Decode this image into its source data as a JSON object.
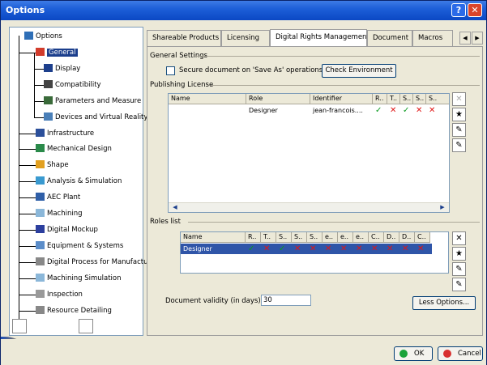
{
  "window": {
    "title": "Options",
    "help": "?",
    "close": "✕"
  },
  "tree": {
    "items": [
      {
        "label": "Options",
        "icon": "options-icon",
        "color": "#2f6fb7"
      },
      {
        "label": "General",
        "icon": "general-icon",
        "color": "#d23c2c",
        "selected": true
      },
      {
        "label": "Display",
        "icon": "display-icon",
        "color": "#1d3f8c"
      },
      {
        "label": "Compatibility",
        "icon": "compatibility-icon",
        "color": "#444444"
      },
      {
        "label": "Parameters and Measure",
        "icon": "parameters-icon",
        "color": "#3a6b3a"
      },
      {
        "label": "Devices and Virtual Reality",
        "icon": "devices-icon",
        "color": "#4a7fb8"
      },
      {
        "label": "Infrastructure",
        "icon": "infrastructure-icon",
        "color": "#2b4f9a"
      },
      {
        "label": "Mechanical Design",
        "icon": "mechanical-design-icon",
        "color": "#2a8a4a"
      },
      {
        "label": "Shape",
        "icon": "shape-icon",
        "color": "#e2a020"
      },
      {
        "label": "Analysis & Simulation",
        "icon": "analysis-icon",
        "color": "#3a9ad0"
      },
      {
        "label": "AEC Plant",
        "icon": "aec-plant-icon",
        "color": "#2f5fa8"
      },
      {
        "label": "Machining",
        "icon": "machining-icon",
        "color": "#8bb7d9"
      },
      {
        "label": "Digital Mockup",
        "icon": "digital-mockup-icon",
        "color": "#2c3f9e"
      },
      {
        "label": "Equipment & Systems",
        "icon": "equipment-icon",
        "color": "#5b8dc9"
      },
      {
        "label": "Digital Process for Manufacturing",
        "icon": "digital-process-icon",
        "color": "#888888"
      },
      {
        "label": "Machining Simulation",
        "icon": "machining-simulation-icon",
        "color": "#8bb7d9"
      },
      {
        "label": "Inspection",
        "icon": "inspection-icon",
        "color": "#999999"
      },
      {
        "label": "Resource Detailing",
        "icon": "resource-detailing-icon",
        "color": "#888888"
      }
    ]
  },
  "tabs": [
    {
      "label": "Shareable Products"
    },
    {
      "label": "Licensing"
    },
    {
      "label": "Digital Rights Management",
      "active": true
    },
    {
      "label": "Document"
    },
    {
      "label": "Macros"
    }
  ],
  "general_settings": {
    "title": "General Settings",
    "secure_label": "Secure document on 'Save As' operations",
    "check_env_label": "Check Environment"
  },
  "publishing_license": {
    "title": "Publishing License",
    "columns": [
      "Name",
      "Role",
      "Identifier",
      "R..",
      "T..",
      "S..",
      "S..",
      "S.."
    ],
    "rows": [
      {
        "name": "",
        "role": "Designer",
        "identifier": "jean-francois....",
        "marks": [
          "ok",
          "x",
          "ok",
          "x",
          "x"
        ]
      }
    ]
  },
  "roles_list": {
    "title": "Roles list",
    "columns": [
      "Name",
      "R..",
      "T..",
      "S..",
      "S..",
      "S..",
      "e..",
      "e..",
      "e..",
      "C..",
      "D..",
      "D..",
      "C.."
    ],
    "rows": [
      {
        "name": "Designer",
        "marks": [
          "ok",
          "x",
          "ok",
          "x",
          "x",
          "x",
          "x",
          "x",
          "x",
          "x",
          "x",
          "x"
        ]
      }
    ]
  },
  "validity": {
    "label": "Document validity (in days) :",
    "value": "30"
  },
  "less_options_label": "Less Options...",
  "ok_label": "OK",
  "cancel_label": "Cancel"
}
